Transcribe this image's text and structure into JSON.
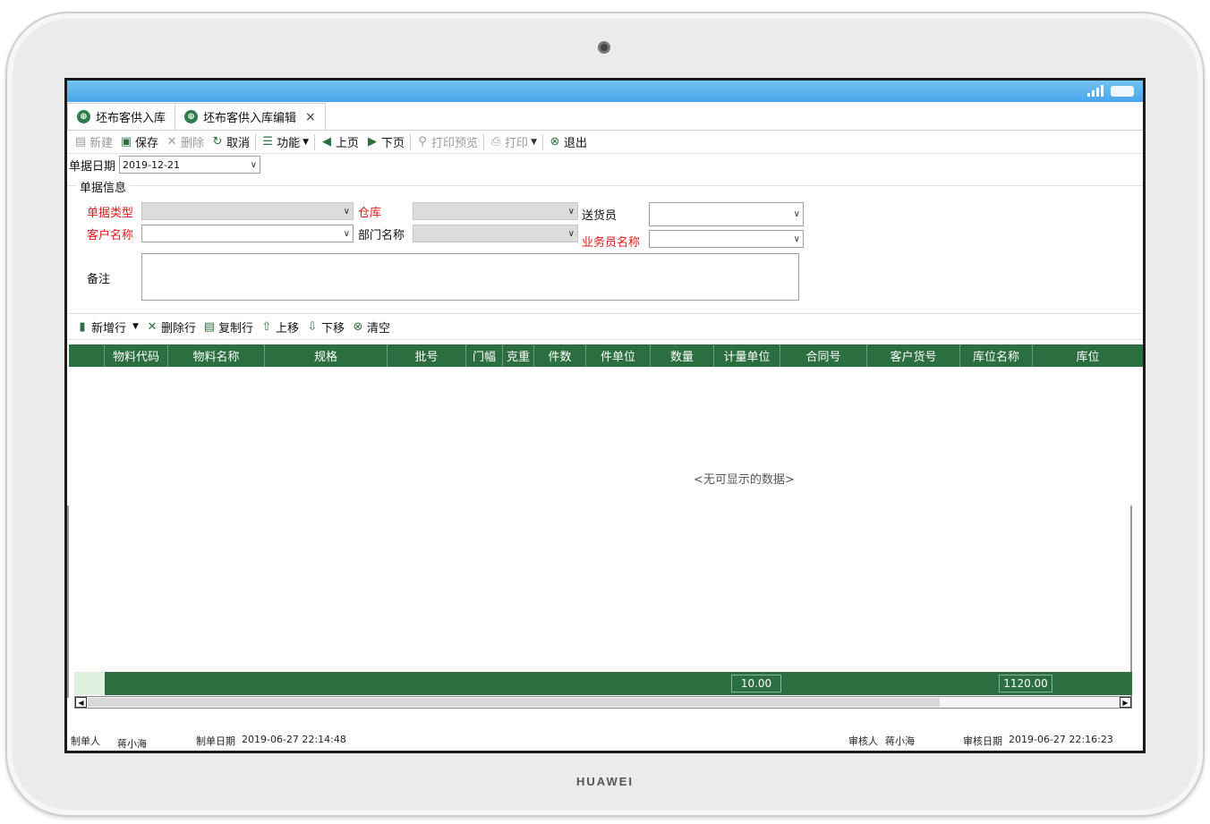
{
  "device": {
    "brand": "HUAWEI"
  },
  "tabs": [
    {
      "label": "坯布客供入库",
      "closable": false
    },
    {
      "label": "坯布客供入库编辑",
      "closable": true,
      "close": "×"
    }
  ],
  "toolbar": {
    "new": "新建",
    "save": "保存",
    "delete": "删除",
    "cancel": "取消",
    "function": "功能",
    "prev": "上页",
    "next": "下页",
    "print_preview": "打印预览",
    "print": "打印",
    "exit": "退出"
  },
  "doc_date": {
    "label": "单据日期",
    "value": "2019-12-21"
  },
  "group": {
    "title": "单据信息",
    "doc_type_label": "单据类型",
    "warehouse_label": "仓库",
    "deliverer_label": "送货员",
    "customer_label": "客户名称",
    "department_label": "部门名称",
    "salesman_label": "业务员名称",
    "remark_label": "备注"
  },
  "grid_toolbar": {
    "add_row": "新增行",
    "delete_row": "删除行",
    "copy_row": "复制行",
    "move_up": "上移",
    "move_down": "下移",
    "clear": "清空"
  },
  "grid": {
    "columns": [
      "物料代码",
      "物料名称",
      "规格",
      "批号",
      "门幅",
      "克重",
      "件数",
      "件单位",
      "数量",
      "计量单位",
      "合同号",
      "客户货号",
      "库位名称",
      "库位"
    ],
    "empty_text": "<无可显示的数据>",
    "summary": {
      "quantity_total": "10.00",
      "amount_total": "1120.00"
    }
  },
  "footer": {
    "maker_label": "制单人",
    "maker": "蒋小海",
    "make_date_label": "制单日期",
    "make_date": "2019-06-27 22:14:48",
    "auditor_label": "审核人",
    "auditor": "蒋小海",
    "audit_date_label": "审核日期",
    "audit_date": "2019-06-27 22:16:23"
  }
}
